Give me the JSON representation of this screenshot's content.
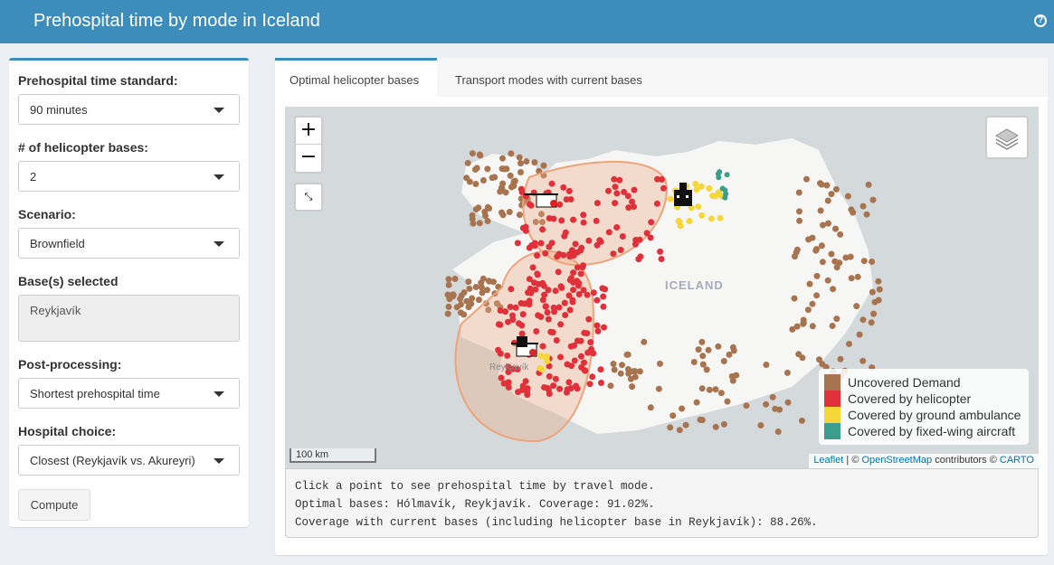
{
  "header": {
    "title": "Prehospital time by mode in Iceland",
    "help_glyph": "?"
  },
  "sidebar": {
    "standard_label": "Prehospital time standard:",
    "standard_value": "90 minutes",
    "bases_label": "# of helicopter bases:",
    "bases_value": "2",
    "scenario_label": "Scenario:",
    "scenario_value": "Brownfield",
    "selected_label": "Base(s) selected",
    "selected_value": "Reykjavík",
    "post_label": "Post-processing:",
    "post_value": "Shortest prehospital time",
    "hospital_label": "Hospital choice:",
    "hospital_value": "Closest (Reykjavík vs. Akureyri)",
    "compute_label": "Compute"
  },
  "tabs": [
    {
      "label": "Optimal helicopter bases",
      "active": true
    },
    {
      "label": "Transport modes with current bases",
      "active": false
    }
  ],
  "map": {
    "zoom_in": "+",
    "zoom_out": "−",
    "country_label": "ICELAND",
    "city_label": "Reykjavík",
    "scale_label": "100 km",
    "attribution_leaflet": "Leaflet",
    "attribution_sep": " | © ",
    "attribution_osm": "OpenStreetMap",
    "attribution_mid": " contributors © ",
    "attribution_carto": "CARTO",
    "legend": [
      {
        "label": "Uncovered Demand",
        "color": "#a87450"
      },
      {
        "label": "Covered by helicopter",
        "color": "#e0303a"
      },
      {
        "label": "Covered by ground ambulance",
        "color": "#f5d73a"
      },
      {
        "label": "Covered by fixed-wing aircraft",
        "color": "#3a9e8c"
      }
    ]
  },
  "output": {
    "line1": "Click a point to see prehospital time by travel mode.",
    "line2": "Optimal bases: Hólmavík, Reykjavík. Coverage: 91.02%.",
    "line3": "Coverage with current bases (including helicopter base in Reykjavík): 88.26%."
  }
}
